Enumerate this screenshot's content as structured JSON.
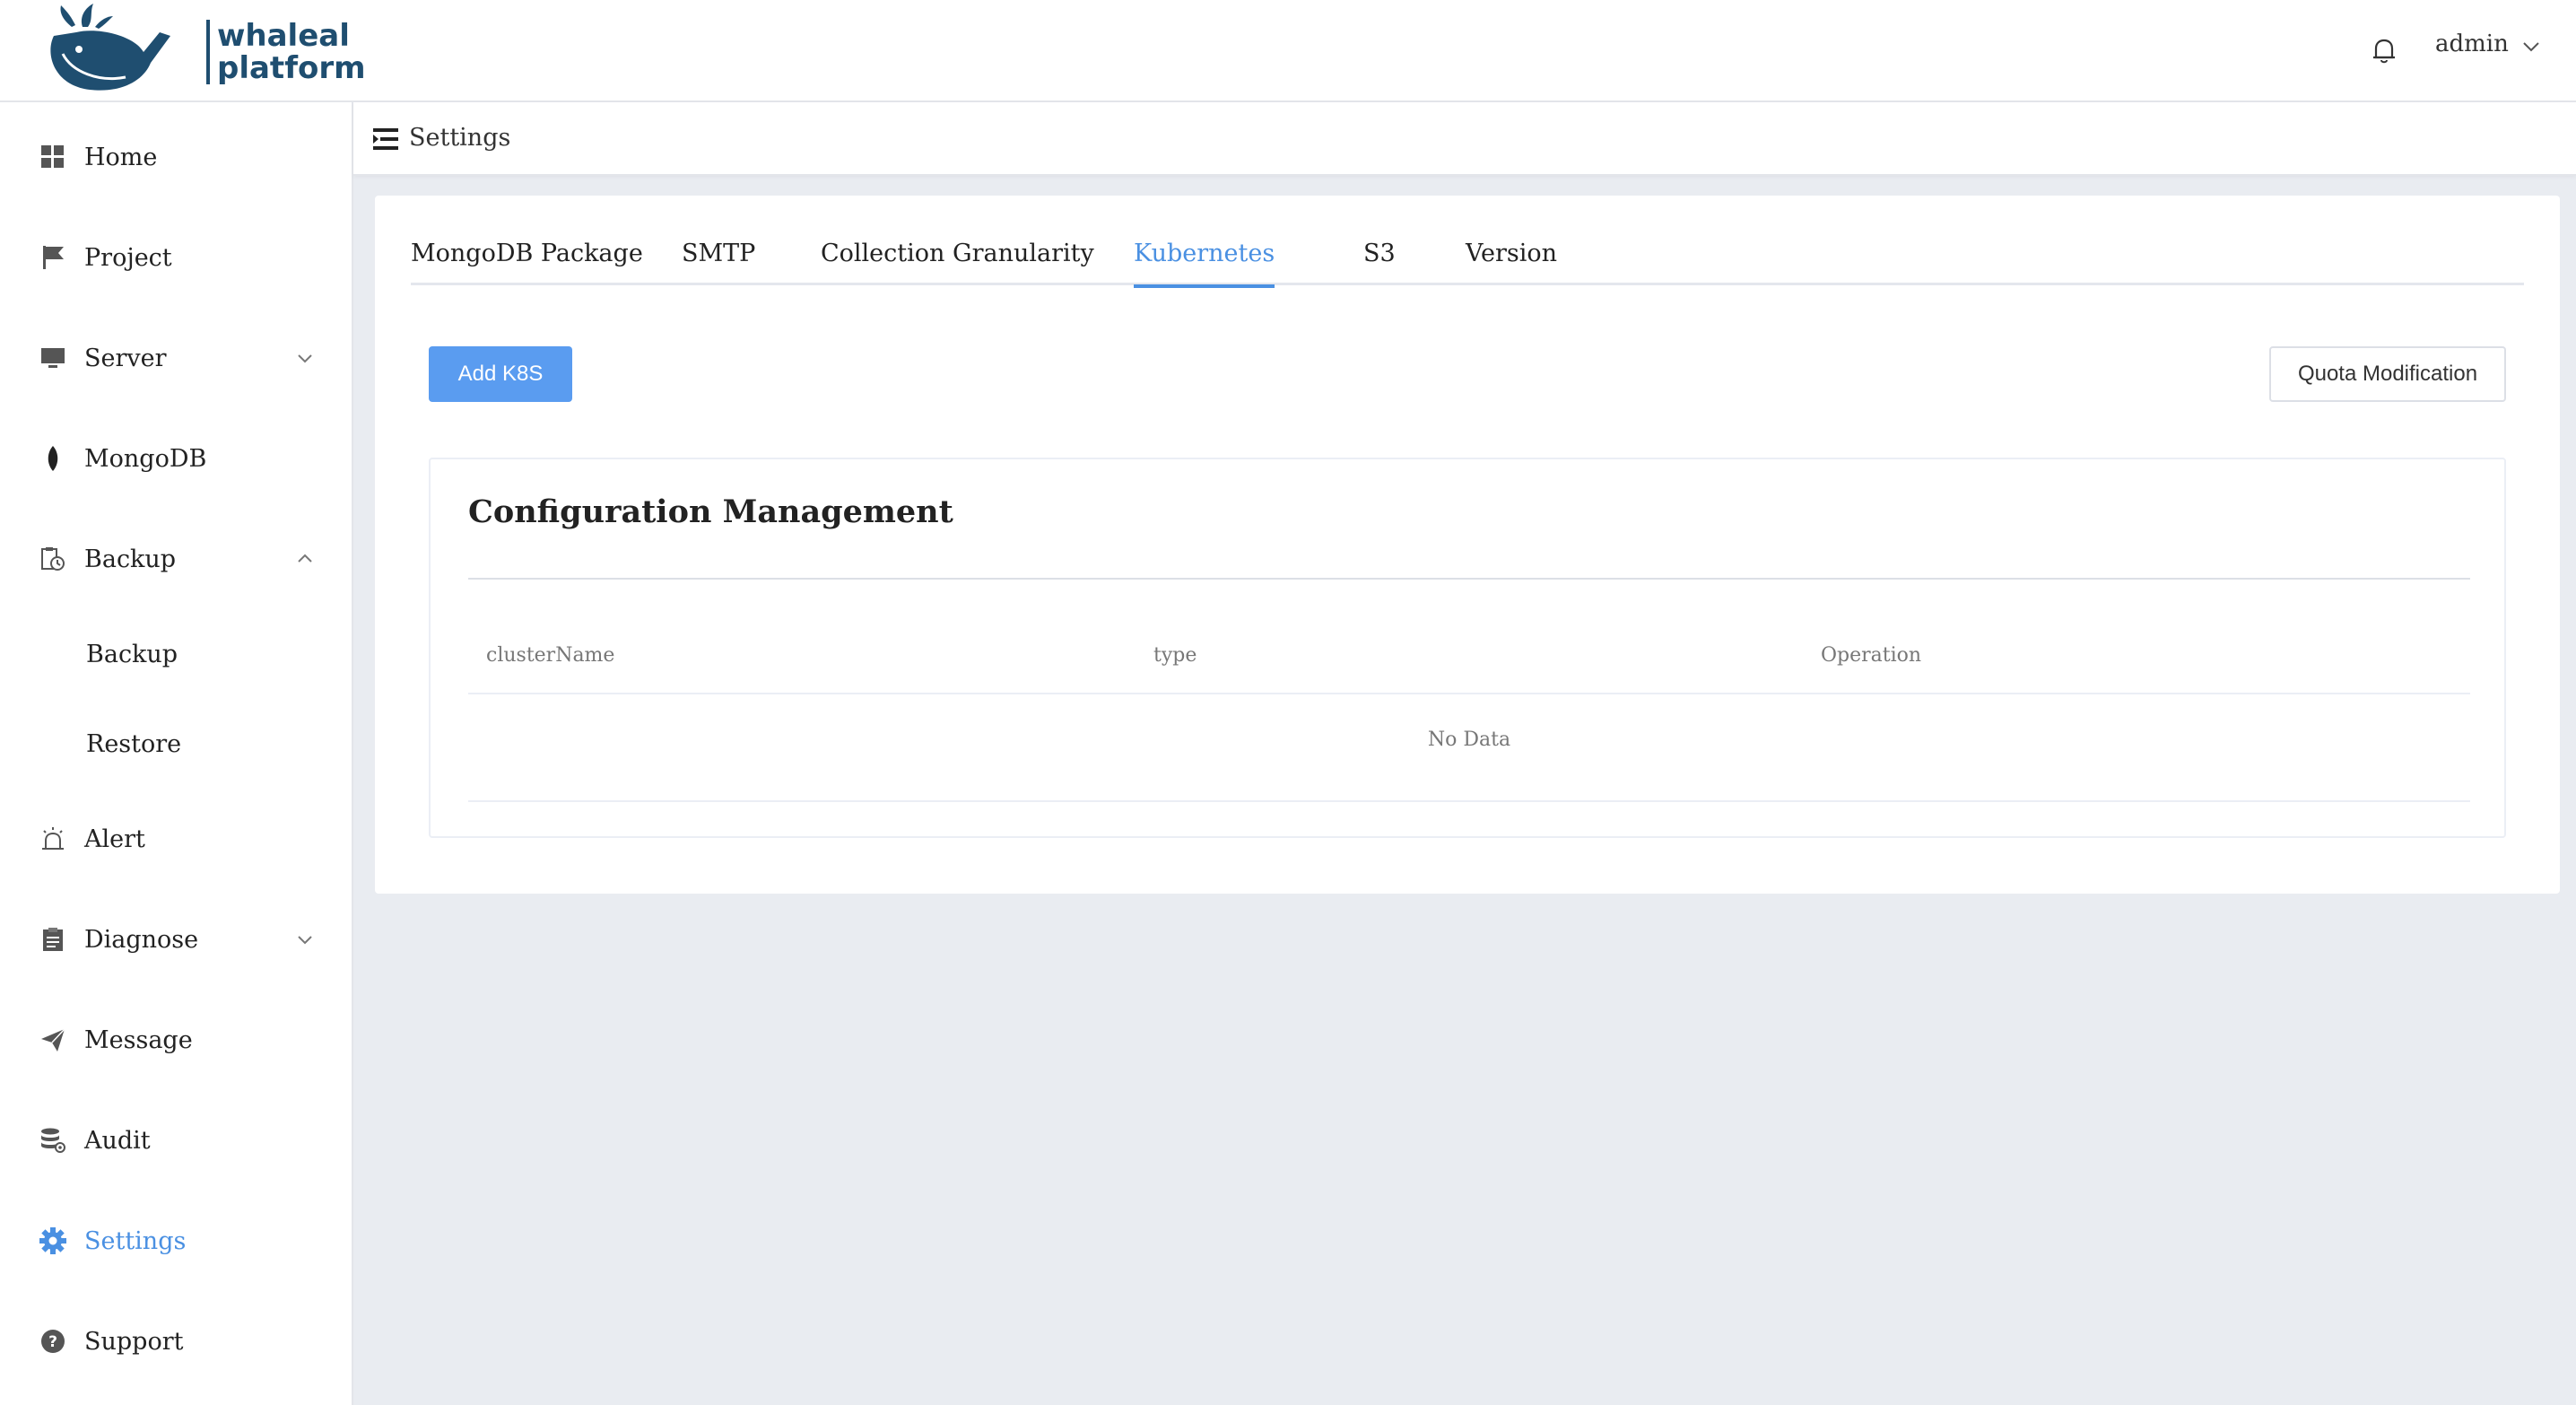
{
  "header": {
    "logo_line1": "whaleal",
    "logo_line2": "platform",
    "user": "admin"
  },
  "sidebar": {
    "items": [
      {
        "label": "Home",
        "icon": "grid-icon"
      },
      {
        "label": "Project",
        "icon": "flag-icon"
      },
      {
        "label": "Server",
        "icon": "monitor-icon"
      },
      {
        "label": "MongoDB",
        "icon": "leaf-icon"
      },
      {
        "label": "Backup",
        "icon": "backup-icon"
      },
      {
        "label": "Backup"
      },
      {
        "label": "Restore"
      },
      {
        "label": "Alert",
        "icon": "alarm-icon"
      },
      {
        "label": "Diagnose",
        "icon": "clipboard-icon"
      },
      {
        "label": "Message",
        "icon": "paper-plane-icon"
      },
      {
        "label": "Audit",
        "icon": "database-icon"
      },
      {
        "label": "Settings",
        "icon": "gear-icon"
      },
      {
        "label": "Support",
        "icon": "help-icon"
      }
    ]
  },
  "breadcrumb": {
    "title": "Settings"
  },
  "tabs": [
    {
      "label": "MongoDB Package"
    },
    {
      "label": "SMTP"
    },
    {
      "label": "Collection Granularity"
    },
    {
      "label": "Kubernetes",
      "active": true
    },
    {
      "label": "S3"
    },
    {
      "label": "Version"
    }
  ],
  "actions": {
    "add": "Add K8S",
    "quota": "Quota Modification"
  },
  "panel": {
    "title": "Configuration Management",
    "columns": [
      "clusterName",
      "type",
      "Operation"
    ],
    "empty_text": "No Data"
  },
  "colors": {
    "accent": "#4a90e2",
    "primary_button": "#5a9cf0",
    "brand": "#1f4e70",
    "background": "#e9ecf1"
  }
}
